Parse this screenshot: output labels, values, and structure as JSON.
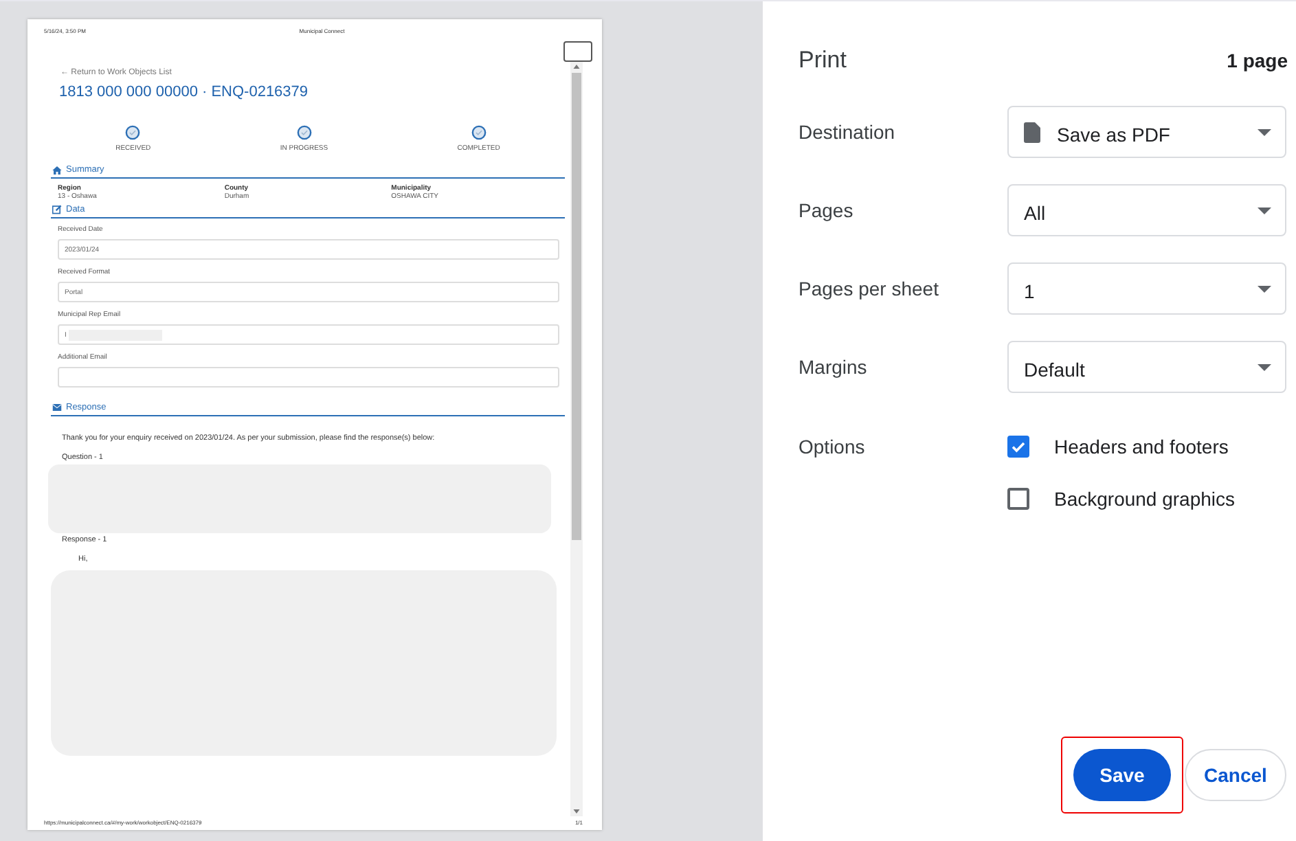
{
  "preview": {
    "header": {
      "date": "5/16/24, 3:50 PM",
      "site": "Municipal Connect"
    },
    "back_link": "← Return to Work Objects List",
    "title": "1813 000 000 00000 · ENQ-0216379",
    "steps": [
      {
        "label": "RECEIVED"
      },
      {
        "label": "IN PROGRESS"
      },
      {
        "label": "COMPLETED"
      }
    ],
    "summary": {
      "heading": "Summary",
      "fields": [
        {
          "label": "Region",
          "value": "13 - Oshawa"
        },
        {
          "label": "County",
          "value": "Durham"
        },
        {
          "label": "Municipality",
          "value": "OSHAWA CITY"
        }
      ]
    },
    "data": {
      "heading": "Data",
      "fields": [
        {
          "label": "Received Date",
          "value": "2023/01/24",
          "redacted": false
        },
        {
          "label": "Received Format",
          "value": "Portal",
          "redacted": false
        },
        {
          "label": "Municipal Rep Email",
          "value": "I",
          "redacted": true
        },
        {
          "label": "Additional Email",
          "redacted": false
        }
      ]
    },
    "response": {
      "heading": "Response",
      "intro": "Thank you for your enquiry received on 2023/01/24.  As per your submission, please find the response(s) below:",
      "question_label": "Question - 1",
      "response_label": "Response - 1",
      "greeting": "Hi,"
    },
    "footer": {
      "url": "https://municipalconnect.ca/#/my-work/workobject/ENQ-0216379",
      "page": "1/1"
    }
  },
  "settings": {
    "title": "Print",
    "page_count": "1 page",
    "rows": [
      {
        "label": "Destination",
        "value": "Save as PDF",
        "kind": "pdf-select"
      },
      {
        "label": "Pages",
        "value": "All",
        "kind": "select"
      },
      {
        "label": "Pages per sheet",
        "value": "1",
        "kind": "select"
      },
      {
        "label": "Margins",
        "value": "Default",
        "kind": "select"
      }
    ],
    "options": {
      "label": "Options",
      "checkboxes": [
        {
          "label": "Headers and footers",
          "checked": true
        },
        {
          "label": "Background graphics",
          "checked": false
        }
      ]
    },
    "buttons": [
      {
        "label": "Save",
        "kind": "primary",
        "highlighted": true
      },
      {
        "label": "Cancel",
        "kind": "secondary",
        "highlighted": false
      }
    ]
  }
}
